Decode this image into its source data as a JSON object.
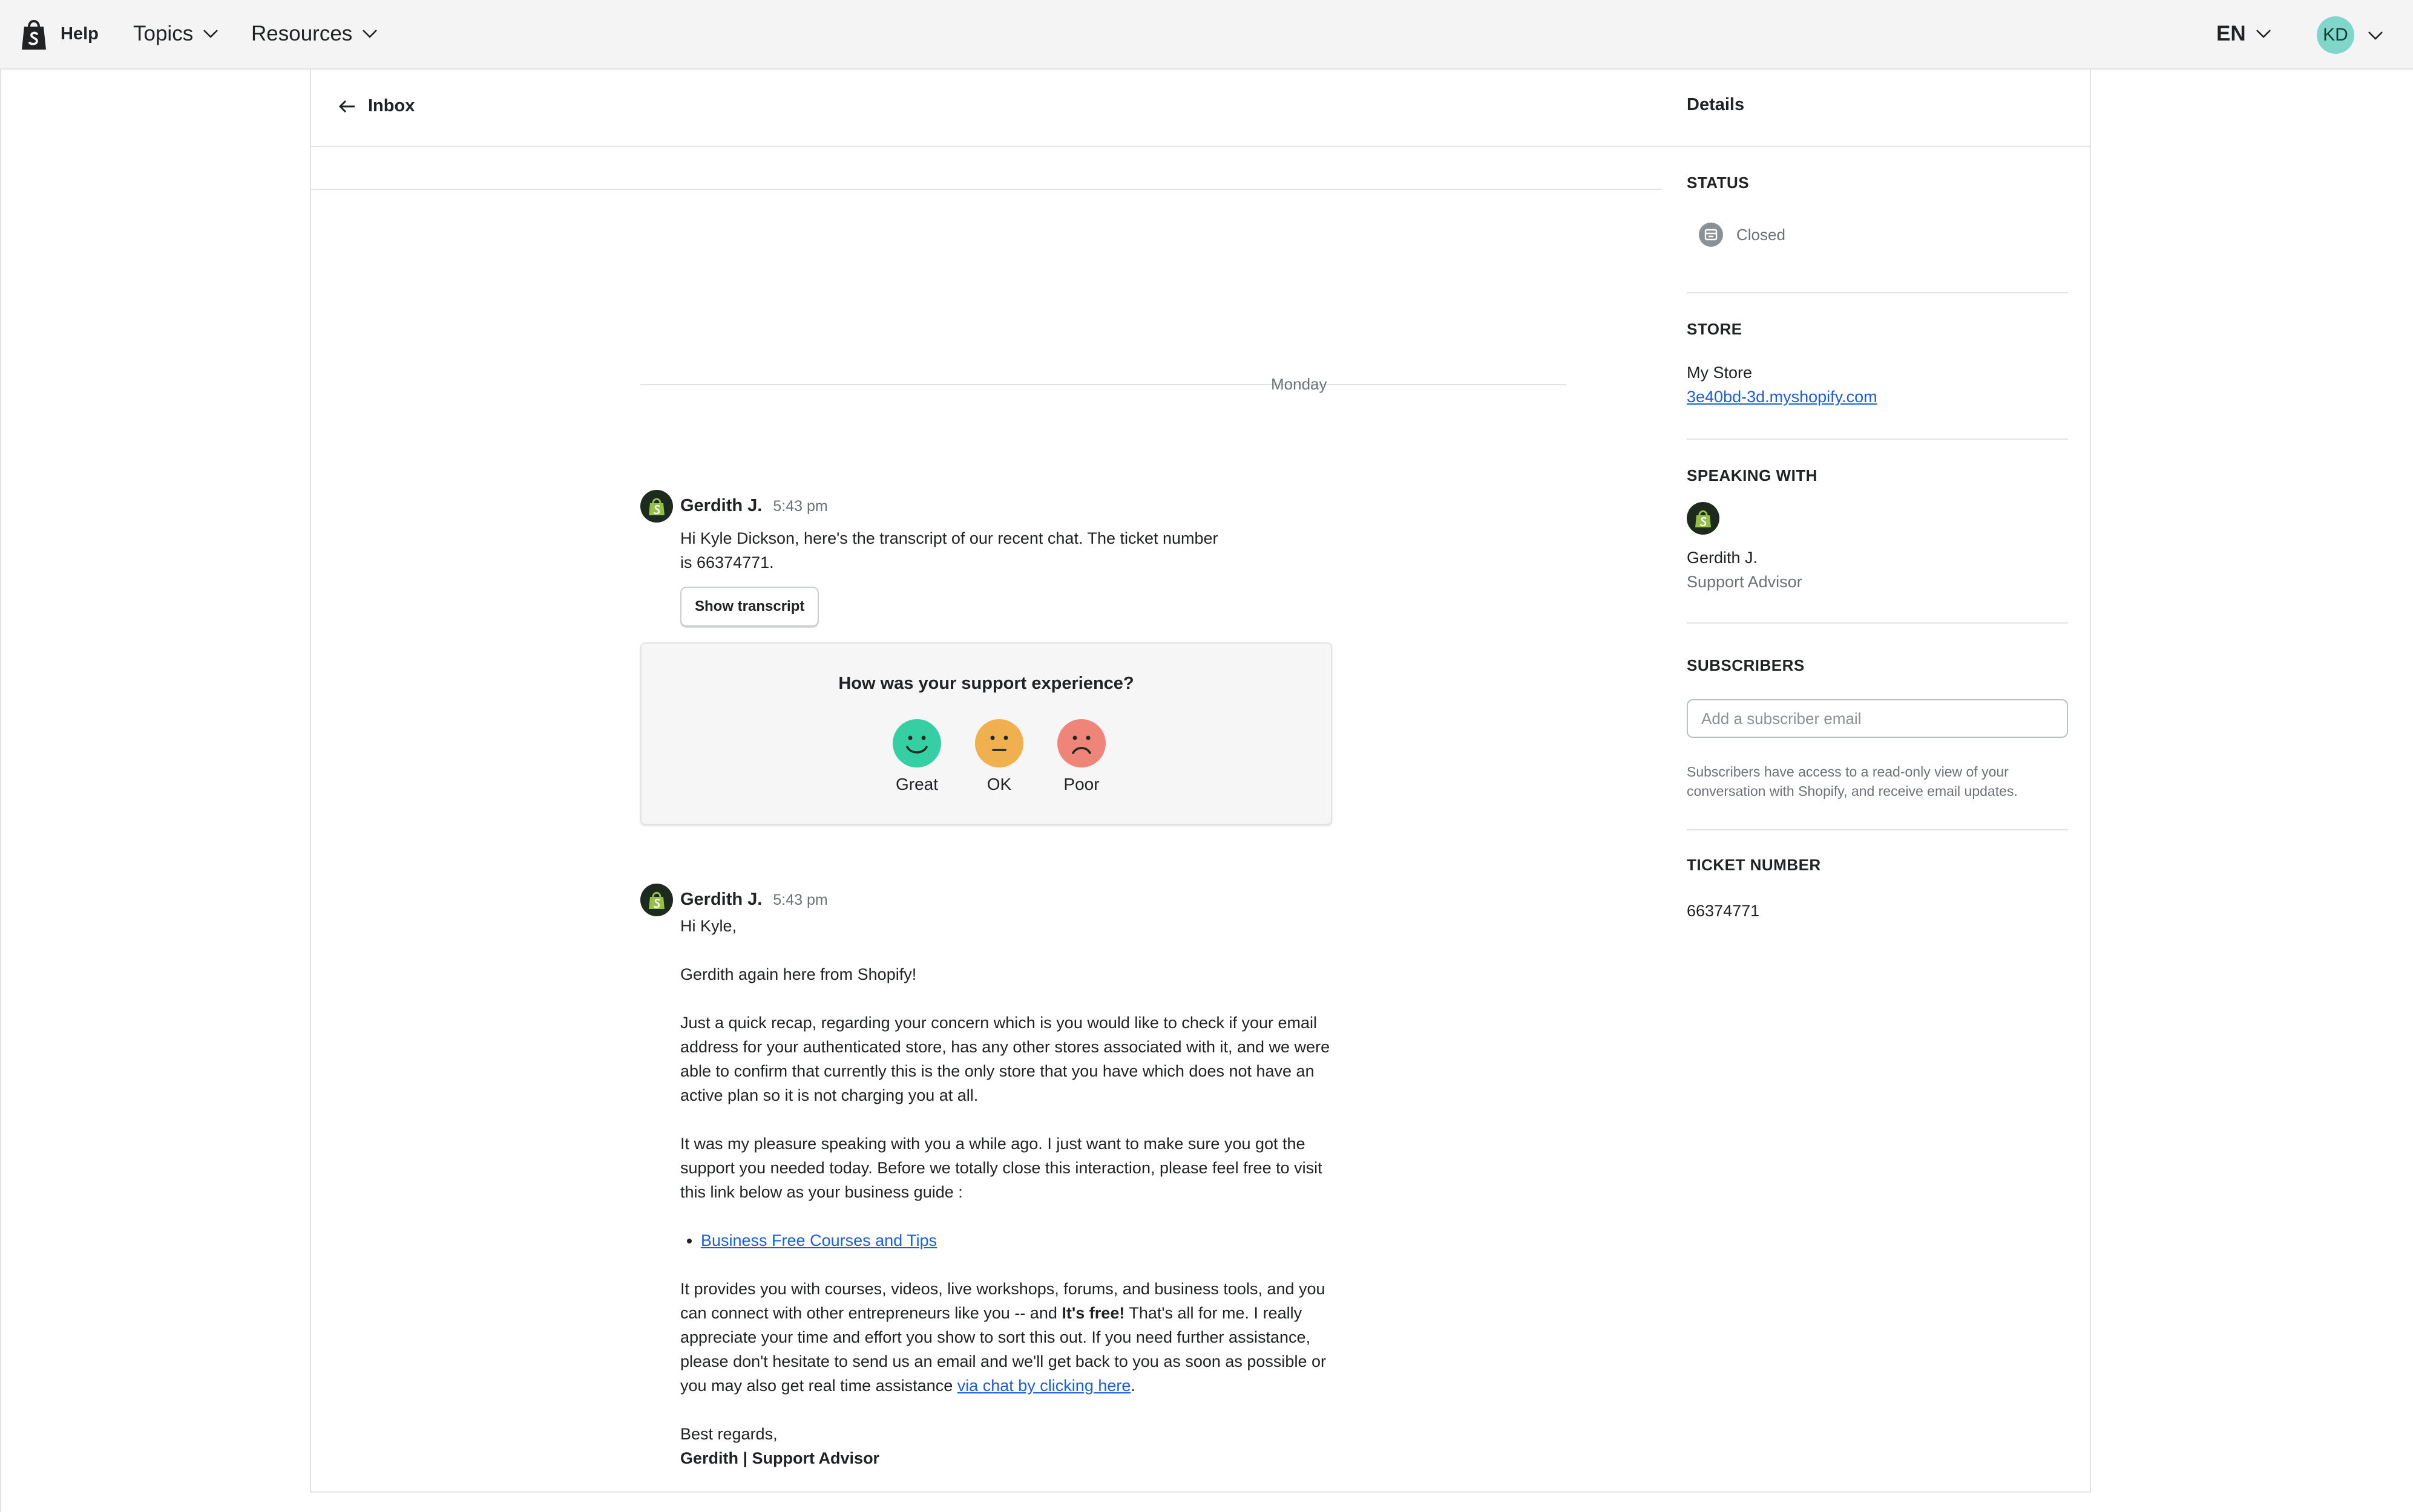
{
  "topbar": {
    "brand_label": "Help",
    "nav": [
      {
        "label": "Topics"
      },
      {
        "label": "Resources"
      }
    ],
    "language": "EN",
    "avatar_initials": "KD"
  },
  "main": {
    "back_label": "Inbox",
    "day_label": "Monday",
    "messages": [
      {
        "author": "Gerdith J.",
        "time": "5:43 pm",
        "text_line1": "Hi Kyle Dickson, here's the transcript of our recent chat. The ticket number",
        "text_line2": "is 66374771.",
        "button_label": "Show transcript"
      },
      {
        "author": "Gerdith J.",
        "time": "5:43 pm",
        "greeting": "Hi Kyle,",
        "p1": "Gerdith again here from Shopify!",
        "p2": "Just a quick recap, regarding your concern which is you would like to check if your email address for your authenticated store, has any other stores associated with it, and we were able to confirm that currently this is the only store that you have which does not have an active plan so it is not charging you at all.",
        "p3": "It was my pleasure speaking with you a while ago. I just want to make sure you got the support you needed today. Before we totally close this interaction, please feel free to visit this link below as your business guide :",
        "link_label": "Business Free Courses and Tips",
        "p4_a": "It provides you with courses, videos, live workshops, forums, and business tools, and you can connect with other entrepreneurs like you -- and",
        "p4_bold": "It's free!",
        "p4_b": "That's all for me. I really appreciate your time and effort you show to sort this out. If you need further assistance, please don't hesitate to send us an email and we'll get back to you as soon as possible or you may also get real time assistance",
        "p4_link": "via chat by clicking here",
        "p4_end": ".",
        "signoff": "Best regards,",
        "signature": "Gerdith | Support Advisor"
      }
    ],
    "survey": {
      "question": "How was your support experience?",
      "options": [
        {
          "label": "Great",
          "color": "#36cfa4"
        },
        {
          "label": "OK",
          "color": "#f0b050"
        },
        {
          "label": "Poor",
          "color": "#ef8478"
        }
      ]
    }
  },
  "sidebar": {
    "title": "Details",
    "status": {
      "heading": "STATUS",
      "value": "Closed"
    },
    "store": {
      "heading": "STORE",
      "name": "My Store",
      "url": "3e40bd-3d.myshopify.com"
    },
    "speaking_with": {
      "heading": "SPEAKING WITH",
      "name": "Gerdith J.",
      "role": "Support Advisor"
    },
    "subscribers": {
      "heading": "SUBSCRIBERS",
      "placeholder": "Add a subscriber email",
      "note": "Subscribers have access to a read-only view of your conversation with Shopify, and receive email updates."
    },
    "ticket": {
      "heading": "TICKET NUMBER",
      "value": "66374771"
    }
  },
  "colors": {
    "accent_link": "#1a5ed8",
    "brand_green": "#95bf47",
    "avatar_bg": "#7fd6c9"
  }
}
